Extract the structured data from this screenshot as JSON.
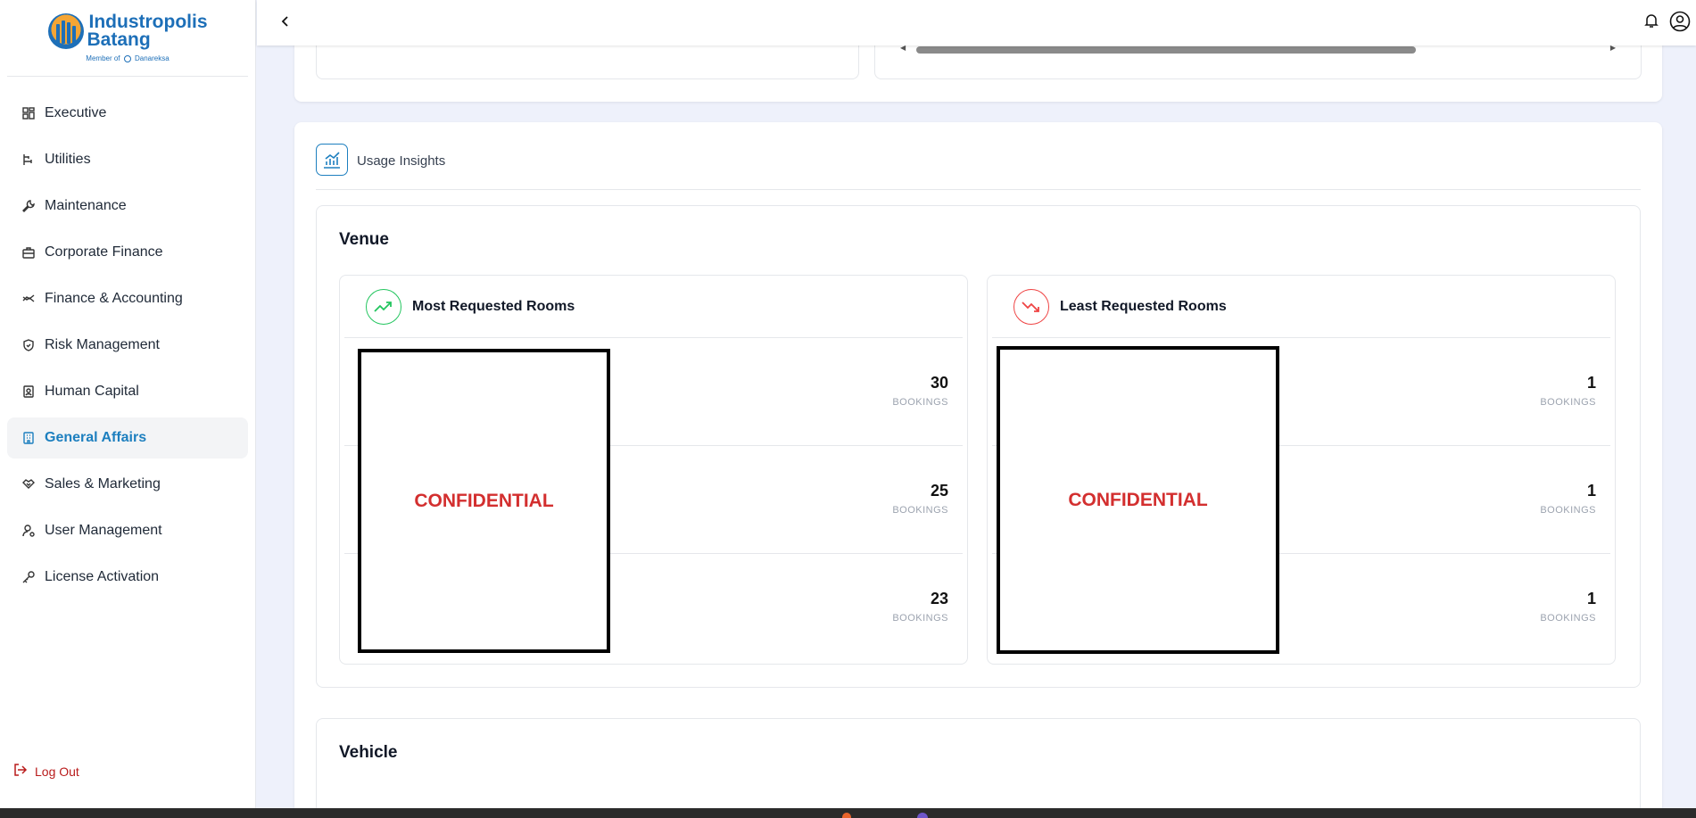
{
  "brand": {
    "name_line1": "Industropolis",
    "name_line2": "Batang",
    "tagline": "Member of",
    "partner": "Danareksa"
  },
  "sidebar": {
    "items": [
      {
        "label": "Executive",
        "icon": "dashboard-icon"
      },
      {
        "label": "Utilities",
        "icon": "utilities-icon"
      },
      {
        "label": "Maintenance",
        "icon": "wrench-icon"
      },
      {
        "label": "Corporate Finance",
        "icon": "briefcase-icon"
      },
      {
        "label": "Finance & Accounting",
        "icon": "coins-icon"
      },
      {
        "label": "Risk Management",
        "icon": "shield-icon"
      },
      {
        "label": "Human Capital",
        "icon": "badge-icon"
      },
      {
        "label": "General Affairs",
        "icon": "building-icon",
        "active": true
      },
      {
        "label": "Sales & Marketing",
        "icon": "handshake-icon"
      },
      {
        "label": "User Management",
        "icon": "user-cog-icon"
      },
      {
        "label": "License Activation",
        "icon": "key-icon"
      }
    ],
    "logout_label": "Log Out"
  },
  "topbar": {
    "back_icon": "chevron-left-icon",
    "notification_icon": "bell-icon",
    "profile_icon": "user-circle-icon"
  },
  "insights": {
    "title": "Usage Insights",
    "venue": {
      "title": "Venue",
      "most": {
        "title": "Most Requested Rooms",
        "rows": [
          {
            "value": "30",
            "unit": "BOOKINGS"
          },
          {
            "value": "25",
            "unit": "BOOKINGS"
          },
          {
            "value": "23",
            "unit": "BOOKINGS"
          }
        ],
        "redaction": "CONFIDENTIAL"
      },
      "least": {
        "title": "Least Requested Rooms",
        "rows": [
          {
            "value": "1",
            "unit": "BOOKINGS"
          },
          {
            "value": "1",
            "unit": "BOOKINGS"
          },
          {
            "value": "1",
            "unit": "BOOKINGS"
          }
        ],
        "redaction": "CONFIDENTIAL"
      }
    },
    "vehicle": {
      "title": "Vehicle"
    }
  },
  "colors": {
    "accent": "#1d7fbf",
    "up": "#22c55e",
    "down": "#ef4444",
    "redaction_text": "#d32f2f"
  }
}
